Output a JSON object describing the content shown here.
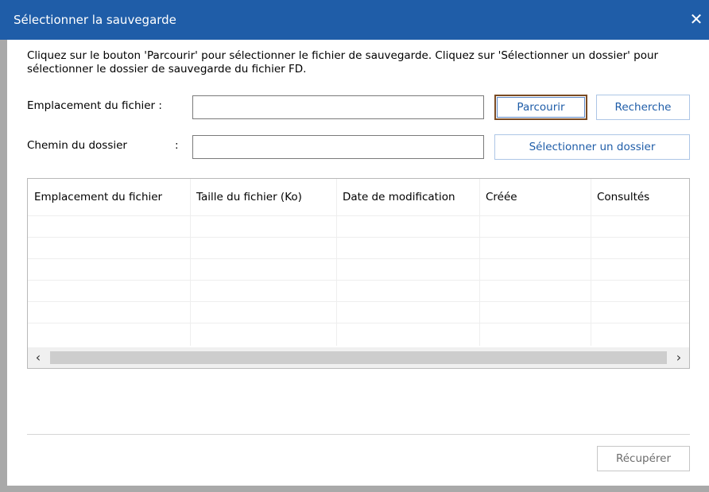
{
  "window": {
    "title": "Sélectionner la sauvegarde",
    "close_glyph": "✕"
  },
  "instructions": "Cliquez sur le bouton 'Parcourir' pour sélectionner le fichier de sauvegarde. Cliquez sur 'Sélectionner un dossier' pour sélectionner le dossier de sauvegarde du fichier FD.",
  "file_location": {
    "label": "Emplacement du fichier :",
    "value": "",
    "browse_label": "Parcourir",
    "search_label": "Recherche"
  },
  "folder_path": {
    "label": "Chemin du dossier",
    "colon": ":",
    "value": "",
    "select_folder_label": "Sélectionner un dossier"
  },
  "table": {
    "columns": [
      "Emplacement du fichier",
      "Taille du fichier (Ko)",
      "Date de modification",
      "Créée",
      "Consultés"
    ],
    "rows": []
  },
  "scrollbar": {
    "left_arrow": "‹",
    "right_arrow": "›"
  },
  "footer": {
    "recover_label": "Récupérer"
  },
  "colors": {
    "titlebar": "#1f5da8",
    "button_text": "#1f5da8",
    "button_border": "#adc6e6",
    "focused_border": "#7a4a22"
  }
}
